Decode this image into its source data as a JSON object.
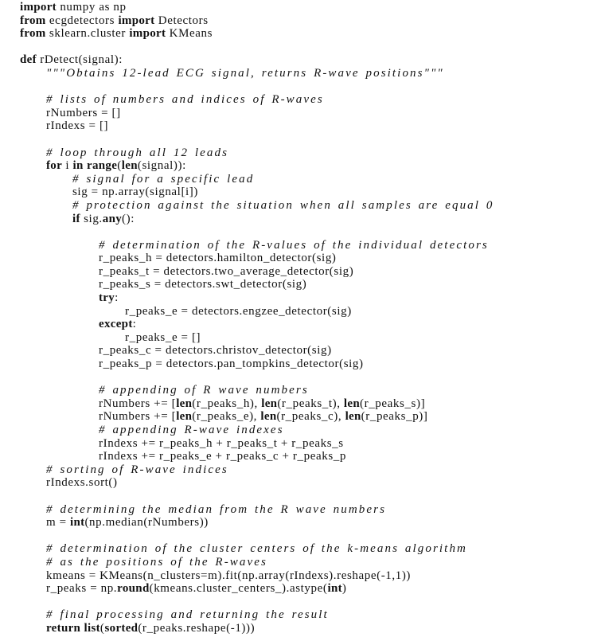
{
  "listing": {
    "language": "python",
    "indent_unit": "    ",
    "lines": [
      {
        "indent": 0,
        "segments": [
          [
            "k",
            "import"
          ],
          [
            "n",
            " numpy as np"
          ]
        ]
      },
      {
        "indent": 0,
        "segments": [
          [
            "k",
            "from"
          ],
          [
            "n",
            " ecgdetectors "
          ],
          [
            "k",
            "import"
          ],
          [
            "n",
            " Detectors"
          ]
        ]
      },
      {
        "indent": 0,
        "segments": [
          [
            "k",
            "from"
          ],
          [
            "n",
            " sklearn.cluster "
          ],
          [
            "k",
            "import"
          ],
          [
            "n",
            " KMeans"
          ]
        ]
      },
      {
        "indent": 0,
        "segments": []
      },
      {
        "indent": 0,
        "segments": [
          [
            "k",
            "def"
          ],
          [
            "n",
            " rDetect(signal):"
          ]
        ]
      },
      {
        "indent": 1,
        "segments": [
          [
            "c",
            "\"\"\"Obtains 12-lead ECG signal, returns R-wave positions\"\"\""
          ]
        ]
      },
      {
        "indent": 0,
        "segments": []
      },
      {
        "indent": 1,
        "segments": [
          [
            "c",
            "# lists of numbers and indices of R-waves"
          ]
        ]
      },
      {
        "indent": 1,
        "segments": [
          [
            "n",
            "rNumbers = []"
          ]
        ]
      },
      {
        "indent": 1,
        "segments": [
          [
            "n",
            "rIndexs = []"
          ]
        ]
      },
      {
        "indent": 0,
        "segments": []
      },
      {
        "indent": 1,
        "segments": [
          [
            "c",
            "# loop through all 12 leads"
          ]
        ]
      },
      {
        "indent": 1,
        "segments": [
          [
            "k",
            "for"
          ],
          [
            "n",
            " i "
          ],
          [
            "k",
            "in"
          ],
          [
            "n",
            " "
          ],
          [
            "k",
            "range"
          ],
          [
            "n",
            "("
          ],
          [
            "k",
            "len"
          ],
          [
            "n",
            "(signal)):"
          ]
        ]
      },
      {
        "indent": 2,
        "segments": [
          [
            "c",
            "# signal for a specific lead"
          ]
        ]
      },
      {
        "indent": 2,
        "segments": [
          [
            "n",
            "sig = np.array(signal[i])"
          ]
        ]
      },
      {
        "indent": 2,
        "segments": [
          [
            "c",
            "# protection against the situation when all samples are equal 0"
          ]
        ]
      },
      {
        "indent": 2,
        "segments": [
          [
            "k",
            "if"
          ],
          [
            "n",
            " sig."
          ],
          [
            "k",
            "any"
          ],
          [
            "n",
            "():"
          ]
        ]
      },
      {
        "indent": 0,
        "segments": []
      },
      {
        "indent": 3,
        "segments": [
          [
            "c",
            "# determination of the R-values of the individual detectors"
          ]
        ]
      },
      {
        "indent": 3,
        "segments": [
          [
            "n",
            "r_peaks_h = detectors.hamilton_detector(sig)"
          ]
        ]
      },
      {
        "indent": 3,
        "segments": [
          [
            "n",
            "r_peaks_t = detectors.two_average_detector(sig)"
          ]
        ]
      },
      {
        "indent": 3,
        "segments": [
          [
            "n",
            "r_peaks_s = detectors.swt_detector(sig)"
          ]
        ]
      },
      {
        "indent": 3,
        "segments": [
          [
            "k",
            "try"
          ],
          [
            "n",
            ":"
          ]
        ]
      },
      {
        "indent": 4,
        "segments": [
          [
            "n",
            "r_peaks_e = detectors.engzee_detector(sig)"
          ]
        ]
      },
      {
        "indent": 3,
        "segments": [
          [
            "k",
            "except"
          ],
          [
            "n",
            ":"
          ]
        ]
      },
      {
        "indent": 4,
        "segments": [
          [
            "n",
            "r_peaks_e = []"
          ]
        ]
      },
      {
        "indent": 3,
        "segments": [
          [
            "n",
            "r_peaks_c = detectors.christov_detector(sig)"
          ]
        ]
      },
      {
        "indent": 3,
        "segments": [
          [
            "n",
            "r_peaks_p = detectors.pan_tompkins_detector(sig)"
          ]
        ]
      },
      {
        "indent": 0,
        "segments": []
      },
      {
        "indent": 3,
        "segments": [
          [
            "c",
            "# appending of R wave numbers"
          ]
        ]
      },
      {
        "indent": 3,
        "segments": [
          [
            "n",
            "rNumbers += ["
          ],
          [
            "k",
            "len"
          ],
          [
            "n",
            "(r_peaks_h), "
          ],
          [
            "k",
            "len"
          ],
          [
            "n",
            "(r_peaks_t), "
          ],
          [
            "k",
            "len"
          ],
          [
            "n",
            "(r_peaks_s)]"
          ]
        ]
      },
      {
        "indent": 3,
        "segments": [
          [
            "n",
            "rNumbers += ["
          ],
          [
            "k",
            "len"
          ],
          [
            "n",
            "(r_peaks_e), "
          ],
          [
            "k",
            "len"
          ],
          [
            "n",
            "(r_peaks_c), "
          ],
          [
            "k",
            "len"
          ],
          [
            "n",
            "(r_peaks_p)]"
          ]
        ]
      },
      {
        "indent": 3,
        "segments": [
          [
            "c",
            "# appending R-wave indexes"
          ]
        ]
      },
      {
        "indent": 3,
        "segments": [
          [
            "n",
            "rIndexs += r_peaks_h + r_peaks_t + r_peaks_s"
          ]
        ]
      },
      {
        "indent": 3,
        "segments": [
          [
            "n",
            "rIndexs += r_peaks_e + r_peaks_c + r_peaks_p"
          ]
        ]
      },
      {
        "indent": 1,
        "segments": [
          [
            "c",
            "# sorting of R-wave indices"
          ]
        ]
      },
      {
        "indent": 1,
        "segments": [
          [
            "n",
            "rIndexs.sort()"
          ]
        ]
      },
      {
        "indent": 0,
        "segments": []
      },
      {
        "indent": 1,
        "segments": [
          [
            "c",
            "# determining the median from the R wave numbers"
          ]
        ]
      },
      {
        "indent": 1,
        "segments": [
          [
            "n",
            "m = "
          ],
          [
            "k",
            "int"
          ],
          [
            "n",
            "(np.median(rNumbers))"
          ]
        ]
      },
      {
        "indent": 0,
        "segments": []
      },
      {
        "indent": 1,
        "segments": [
          [
            "c",
            "# determination of the cluster centers of the k-means algorithm"
          ]
        ]
      },
      {
        "indent": 1,
        "segments": [
          [
            "c",
            "# as the positions of the R-waves"
          ]
        ]
      },
      {
        "indent": 1,
        "segments": [
          [
            "n",
            "kmeans = KMeans(n_clusters=m).fit(np.array(rIndexs).reshape(-1,1))"
          ]
        ]
      },
      {
        "indent": 1,
        "segments": [
          [
            "n",
            "r_peaks = np."
          ],
          [
            "k",
            "round"
          ],
          [
            "n",
            "(kmeans.cluster_centers_).astype("
          ],
          [
            "k",
            "int"
          ],
          [
            "n",
            ")"
          ]
        ]
      },
      {
        "indent": 0,
        "segments": []
      },
      {
        "indent": 1,
        "segments": [
          [
            "c",
            "# final processing and returning the result"
          ]
        ]
      },
      {
        "indent": 1,
        "segments": [
          [
            "k",
            "return"
          ],
          [
            "n",
            " "
          ],
          [
            "k",
            "list"
          ],
          [
            "n",
            "("
          ],
          [
            "k",
            "sorted"
          ],
          [
            "n",
            "(r_peaks.reshape(-1)))"
          ]
        ]
      }
    ]
  }
}
